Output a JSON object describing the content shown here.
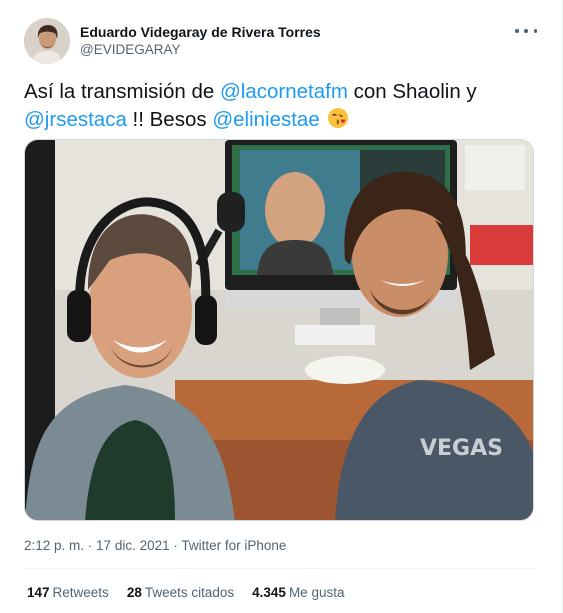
{
  "author": {
    "display_name": "Eduardo Videgaray de Rivera Torres",
    "handle": "@EVIDEGARAY"
  },
  "tweet": {
    "segments": [
      {
        "text": "Así la transmisión de ",
        "type": "text"
      },
      {
        "text": "@lacornetafm",
        "type": "mention"
      },
      {
        "text": " con Shaolin y ",
        "type": "text"
      },
      {
        "text": "@jrsestaca",
        "type": "mention"
      },
      {
        "text": " !! Besos ",
        "type": "text"
      },
      {
        "text": "@eliniestae",
        "type": "mention"
      }
    ],
    "emoji": "face-blowing-kiss-icon"
  },
  "meta": {
    "time": "2:12 p. m.",
    "separator": " · ",
    "date": "17 dic. 2021",
    "source": "Twitter for iPhone"
  },
  "stats": {
    "retweets_count": "147",
    "retweets_label": "Retweets",
    "quotes_count": "28",
    "quotes_label": "Tweets citados",
    "likes_count": "4.345",
    "likes_label": "Me gusta"
  },
  "colors": {
    "mention": "#1d9bf0",
    "text": "#0f1419",
    "secondary": "#536471"
  }
}
